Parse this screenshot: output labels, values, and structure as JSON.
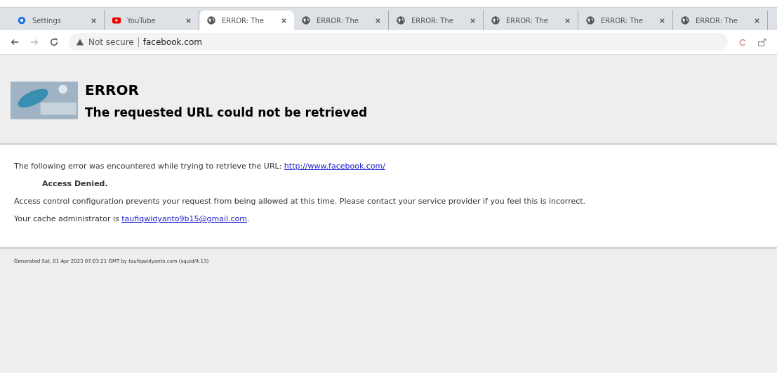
{
  "browser": {
    "tabs": [
      {
        "title": "Settings",
        "kind": "settings",
        "selected": false
      },
      {
        "title": "YouTube",
        "kind": "video",
        "selected": false
      },
      {
        "title": "ERROR: The",
        "kind": "web",
        "selected": true
      },
      {
        "title": "ERROR: The",
        "kind": "web",
        "selected": false
      },
      {
        "title": "ERROR: The",
        "kind": "web",
        "selected": false
      },
      {
        "title": "ERROR: The",
        "kind": "web",
        "selected": false
      },
      {
        "title": "ERROR: The",
        "kind": "web",
        "selected": false
      },
      {
        "title": "ERROR: The",
        "kind": "web",
        "selected": false
      }
    ],
    "address_bar": {
      "security": "Not secure",
      "url": "facebook.com"
    }
  },
  "page": {
    "title": "ERROR",
    "subtitle": "The requested URL could not be retrieved",
    "intro": "The following error was encountered while trying to retrieve the URL:",
    "intro_link": "http://www.facebook.com/",
    "error": "Access Denied.",
    "explanation": "Access control configuration prevents your request from being allowed at this time. Please contact your service provider if you feel this is incorrect.",
    "admin": "Your cache administrator is",
    "admin_link": "taufiqwidyanto9b15@gmail.com",
    "admin_end": ".",
    "footer": "Generated Sat, 01 Apr 2023 07:03:21 GMT by taufiqwidyanto.com (squid/4.13)"
  }
}
